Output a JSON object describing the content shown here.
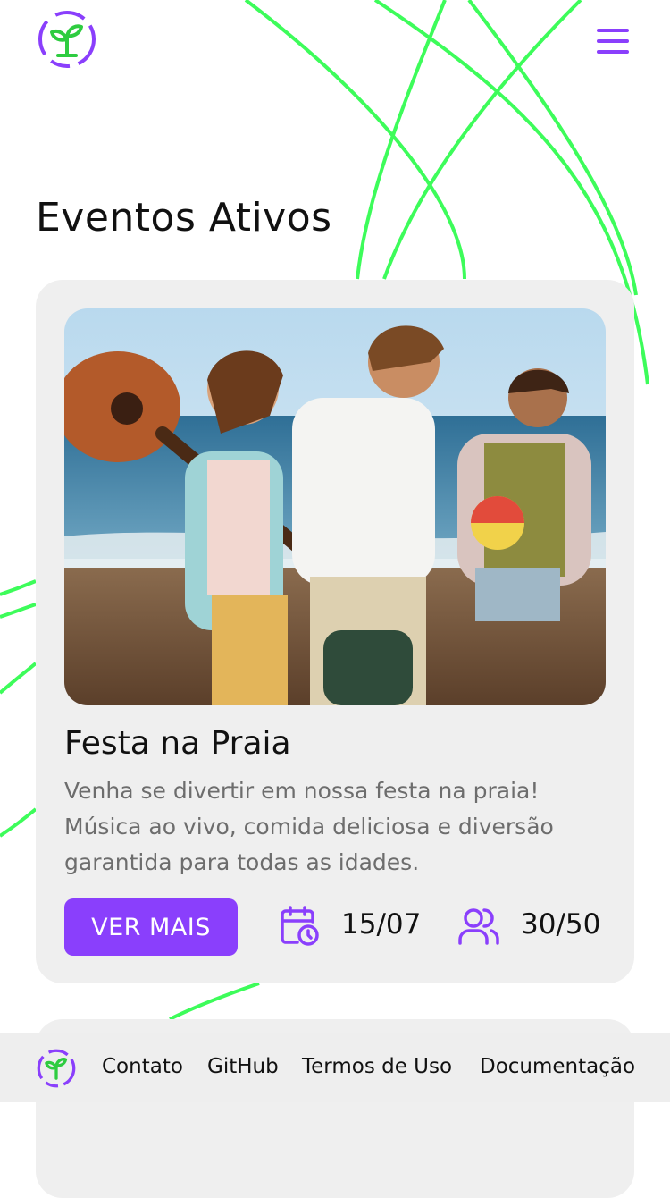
{
  "header": {
    "logo_icon": "sprout-logo-icon",
    "menu_icon": "hamburger-menu-icon"
  },
  "page": {
    "title": "Eventos Ativos"
  },
  "event": {
    "title": "Festa na Praia",
    "description": "Venha se divertir em nossa festa na praia! Música ao vivo, comida deliciosa e diversão garantida para todas as idades.",
    "button_label": "VER MAIS",
    "date_icon": "calendar-clock-icon",
    "date": "15/07",
    "participants_icon": "users-icon",
    "participants": "30/50"
  },
  "footer": {
    "logo_icon": "sprout-logo-icon",
    "links": [
      "Contato",
      "GitHub",
      "Termos de Uso",
      "Documentação"
    ]
  },
  "colors": {
    "accent": "#8a3ffc",
    "accent_green": "#2ecc40",
    "line_green": "#3dfc5a",
    "card_bg": "#efefef",
    "footer_bg": "#eeeeee",
    "description_text": "#6d6d6d"
  }
}
